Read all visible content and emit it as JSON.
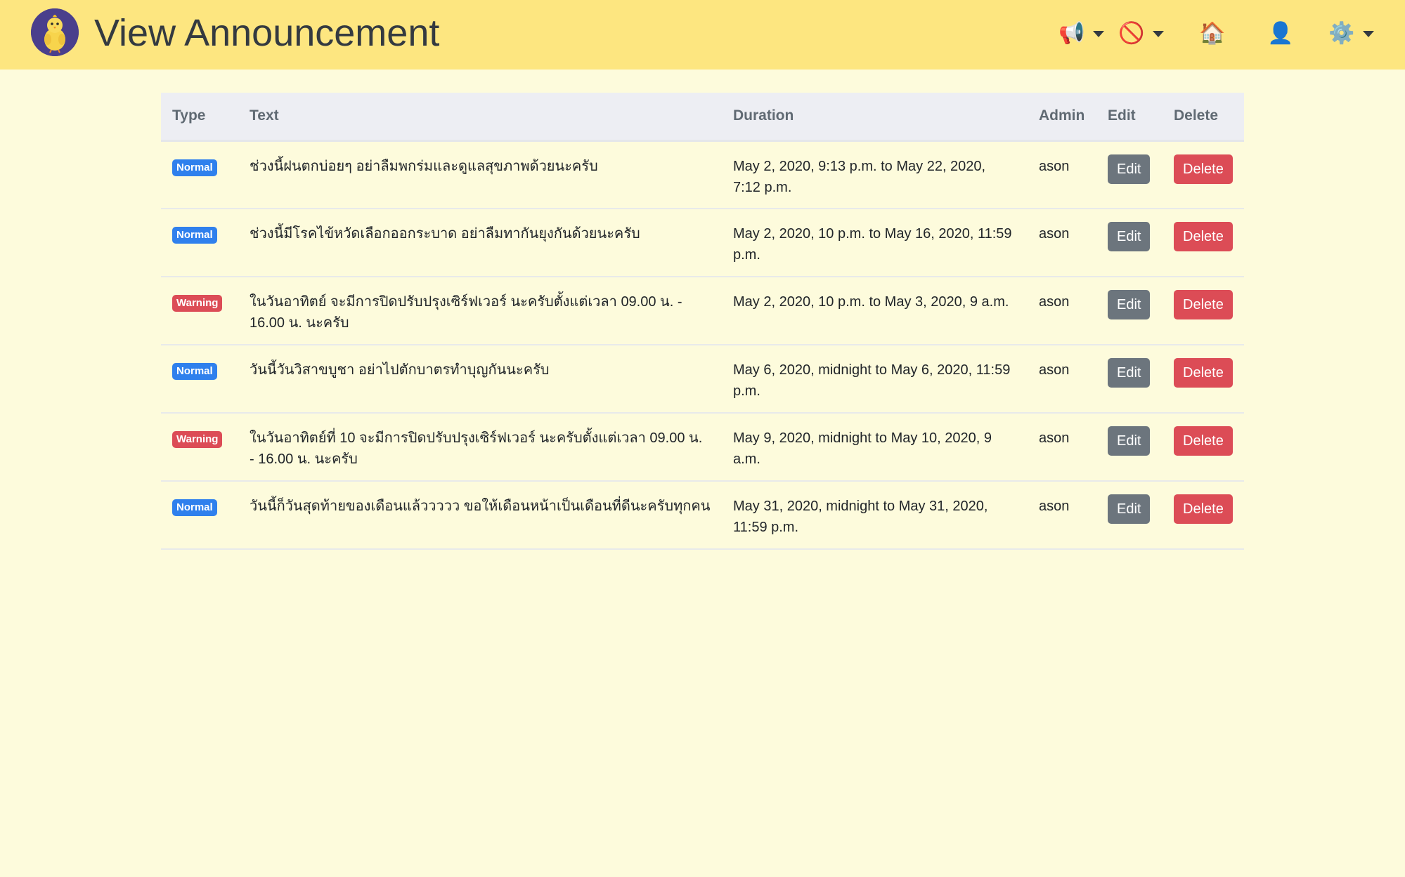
{
  "header": {
    "title": "View Announcement",
    "nav": [
      {
        "icon": "megaphone-icon",
        "glyph": "📢",
        "has_dropdown": true
      },
      {
        "icon": "prohibited-icon",
        "glyph": "🚫",
        "has_dropdown": true
      },
      {
        "icon": "home-icon",
        "glyph": "🏠",
        "has_dropdown": false
      },
      {
        "icon": "user-icon",
        "glyph": "👤",
        "has_dropdown": false
      },
      {
        "icon": "gear-icon",
        "glyph": "⚙️",
        "has_dropdown": true
      }
    ]
  },
  "table": {
    "columns": [
      "Type",
      "Text",
      "Duration",
      "Admin",
      "Edit",
      "Delete"
    ],
    "rows": [
      {
        "type": "Normal",
        "text": "ช่วงนี้ฝนตกบ่อยๆ อย่าลืมพกร่มและดูแลสุขภาพด้วยนะครับ",
        "duration": "May 2, 2020, 9:13 p.m. to May 22, 2020, 7:12 p.m.",
        "admin": "ason",
        "edit_label": "Edit",
        "delete_label": "Delete"
      },
      {
        "type": "Normal",
        "text": "ช่วงนี้มีโรคไข้หวัดเลือกออกระบาด อย่าลืมทากันยุงกันด้วยนะครับ",
        "duration": "May 2, 2020, 10 p.m. to May 16, 2020, 11:59 p.m.",
        "admin": "ason",
        "edit_label": "Edit",
        "delete_label": "Delete"
      },
      {
        "type": "Warning",
        "text": "ในวันอาทิตย์ จะมีการปิดปรับปรุงเซิร์ฟเวอร์ นะครับตั้งแต่เวลา 09.00 น. - 16.00 น. นะครับ",
        "duration": "May 2, 2020, 10 p.m. to May 3, 2020, 9 a.m.",
        "admin": "ason",
        "edit_label": "Edit",
        "delete_label": "Delete"
      },
      {
        "type": "Normal",
        "text": "วันนี้วันวิสาขบูชา อย่าไปตักบาตรทำบุญกันนะครับ",
        "duration": "May 6, 2020, midnight to May 6, 2020, 11:59 p.m.",
        "admin": "ason",
        "edit_label": "Edit",
        "delete_label": "Delete"
      },
      {
        "type": "Warning",
        "text": "ในวันอาทิตย์ที่ 10 จะมีการปิดปรับปรุงเซิร์ฟเวอร์ นะครับตั้งแต่เวลา 09.00 น. - 16.00 น. นะครับ",
        "duration": "May 9, 2020, midnight to May 10, 2020, 9 a.m.",
        "admin": "ason",
        "edit_label": "Edit",
        "delete_label": "Delete"
      },
      {
        "type": "Normal",
        "text": "วันนี้ก็วันสุดท้ายของเดือนแล้ววววว ขอให้เดือนหน้าเป็นเดือนที่ดีนะครับทุกคน",
        "duration": "May 31, 2020, midnight to May 31, 2020, 11:59 p.m.",
        "admin": "ason",
        "edit_label": "Edit",
        "delete_label": "Delete"
      }
    ]
  },
  "colors": {
    "header_bg": "#fde680",
    "page_bg": "#fdfbdc",
    "normal_badge": "#2f80ed",
    "warning_badge": "#dc4c56",
    "edit_button": "#6c757d",
    "delete_button": "#dc4c56"
  }
}
